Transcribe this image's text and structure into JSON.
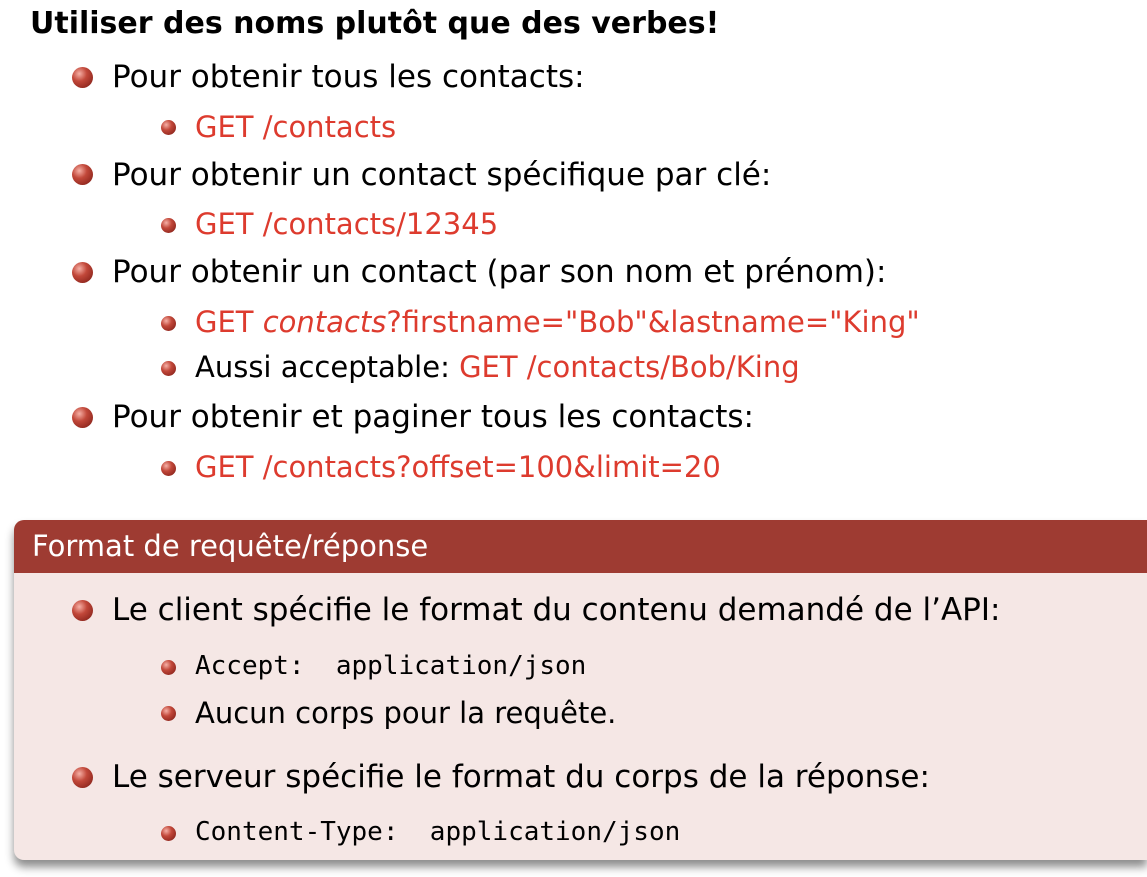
{
  "heading": "Utiliser des noms plutôt que des verbes!",
  "items": [
    {
      "label": "Pour obtenir tous les contacts:",
      "sub": [
        {
          "text": "GET /contacts"
        }
      ]
    },
    {
      "label": "Pour obtenir un contact spécifique par clé:",
      "sub": [
        {
          "text": "GET /contacts/12345"
        }
      ]
    },
    {
      "label": "Pour obtenir un contact (par son nom et prénom):",
      "sub": [
        {
          "pre": "GET ",
          "italic": "contacts",
          "post": "?firstname=\"Bob\"&lastname=\"King\""
        },
        {
          "label": "Aussi acceptable: ",
          "text": "GET /contacts/Bob/King"
        }
      ]
    },
    {
      "label": "Pour obtenir et paginer tous les contacts:",
      "sub": [
        {
          "text": "GET /contacts?offset=100&limit=20"
        }
      ]
    }
  ],
  "block": {
    "title": "Format de requête/réponse",
    "items": [
      {
        "label": "Le client spécifie le format du contenu demandé de l’API:",
        "sub": [
          {
            "code": "Accept:  application/json"
          },
          {
            "text": "Aucun corps pour la requête."
          }
        ]
      },
      {
        "label": "Le serveur spécifie le format du corps de la réponse:",
        "sub": [
          {
            "code": "Content-Type:  application/json"
          }
        ]
      }
    ]
  },
  "colors": {
    "accent_red": "#dd3b2e",
    "block_title_bg": "#9e3b32",
    "block_body_bg": "#f5e7e5"
  }
}
